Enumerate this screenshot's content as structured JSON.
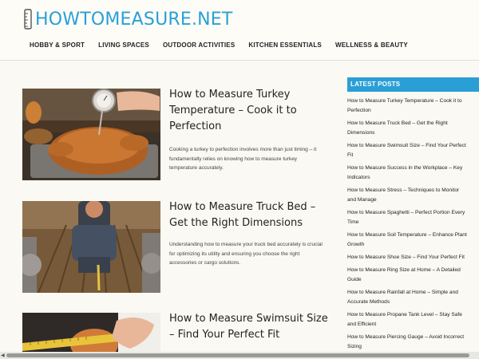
{
  "site": {
    "logo_text": "HOWTOMEASURE.NET",
    "brand_color": "#2aa0d6"
  },
  "nav": [
    {
      "label": "HOBBY & SPORT"
    },
    {
      "label": "LIVING SPACES"
    },
    {
      "label": "OUTDOOR ACTIVITIES"
    },
    {
      "label": "KITCHEN ESSENTIALS"
    },
    {
      "label": "WELLNESS & BEAUTY"
    }
  ],
  "posts": [
    {
      "title": "How to Measure Turkey Temperature – Cook it to Perfection",
      "excerpt": "Cooking a turkey to perfection involves more than just timing – it fundamentally relies on knowing how to measure turkey temperature accurately.",
      "image": "roast-turkey-with-thermometer"
    },
    {
      "title": "How to Measure Truck Bed – Get the Right Dimensions",
      "excerpt": "Understanding how to measure your truck bed accurately is crucial for optimizing its utility and ensuring you choose the right accessories or cargo solutions.",
      "image": "man-measuring-truck-bed"
    },
    {
      "title": "How to Measure Swimsuit Size – Find Your Perfect Fit",
      "excerpt": "",
      "image": "tape-measure-swimsuit"
    }
  ],
  "sidebar": {
    "heading": "LATEST POSTS",
    "items": [
      {
        "l1": "How to Measure Turkey Temperature – Cook it to",
        "l2": "Perfection"
      },
      {
        "l1": "How to Measure Truck Bed – Get the Right",
        "l2": "Dimensions"
      },
      {
        "l1": "How to Measure Swimsuit Size – Find Your Perfect",
        "l2": "Fit"
      },
      {
        "l1": "How to Measure Success in the Workplace – Key",
        "l2": "Indicators"
      },
      {
        "l1": "How to Measure Stress – Techniques to Monitor",
        "l2": "and Manage"
      },
      {
        "l1": "How to Measure Spaghetti – Perfect Portion Every",
        "l2": "Time"
      },
      {
        "l1": "How to Measure Soil Temperature – Enhance Plant",
        "l2": "Growth"
      },
      {
        "l1": "How to Measure Shoe Size – Find Your Perfect Fit",
        "l2": ""
      },
      {
        "l1": "How to Measure Ring Size at Home – A Detailed",
        "l2": "Guide"
      },
      {
        "l1": "How to Measure Rainfall at Home – Simple and",
        "l2": "Accurate Methods"
      },
      {
        "l1": "How to Measure Propane Tank Level – Stay Safe",
        "l2": "and Efficient"
      },
      {
        "l1": "How to Measure Piercing Gauge – Avoid Incorrect",
        "l2": "Sizing"
      }
    ]
  }
}
